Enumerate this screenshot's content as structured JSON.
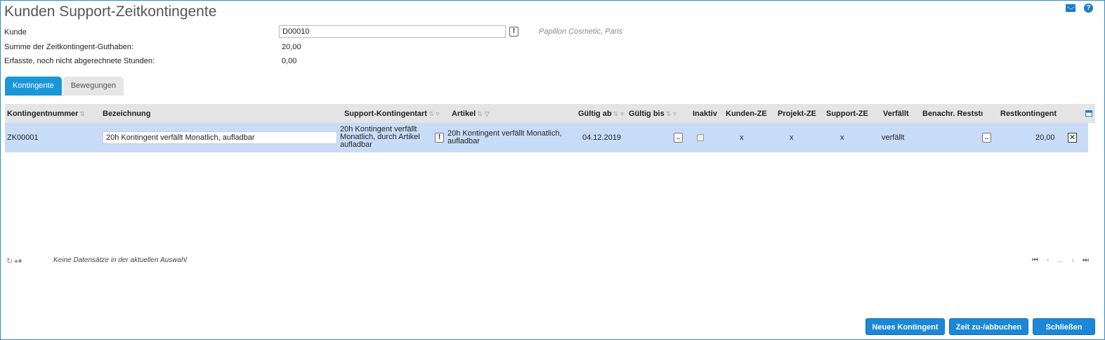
{
  "header": {
    "title": "Kunden Support-Zeitkontingente"
  },
  "icons": {
    "mail": "mail-icon",
    "help": "help-icon"
  },
  "form": {
    "kunde_label": "Kunde",
    "kunde_value": "D00010",
    "kunde_name": "Papillon Cosmetic, Paris",
    "summe_label": "Summe der Zeitkontingent-Guthaben:",
    "summe_value": "20,00",
    "erfasste_label": "Erfasste, noch nicht abgerechnete Stunden:",
    "erfasste_value": "0,00"
  },
  "tabs": [
    {
      "label": "Kontingente",
      "active": true
    },
    {
      "label": "Bewegungen",
      "active": false
    }
  ],
  "table": {
    "columns": {
      "kontingentnummer": "Kontingentnummer",
      "bezeichnung": "Bezeichnung",
      "support_kontingentart": "Support-Kontingentart",
      "artikel": "Artikel",
      "gueltig_ab": "Gültig ab",
      "gueltig_bis": "Gültig bis",
      "inaktiv": "Inaktiv",
      "kunden_ze": "Kunden-ZE",
      "projekt_ze": "Projekt-ZE",
      "support_ze": "Support-ZE",
      "verfaellt": "Verfällt",
      "benachr_reststd": "Benachr. Reststı",
      "restkontingent": "Restkontingent"
    },
    "rows": [
      {
        "kontingentnummer": "ZK00001",
        "bezeichnung": "20h Kontingent verfällt Monatlich, aufladbar",
        "support_kontingentart": "20h Kontingent verfällt Monatlich, durch Artikel aufladbar",
        "artikel": "20h Kontingent verfällt Monatlich, aufladbar",
        "gueltig_ab": "04.12.2019",
        "gueltig_bis_btn": "..",
        "inaktiv": false,
        "kunden_ze": "x",
        "projekt_ze": "x",
        "support_ze": "x",
        "verfaellt": "verfällt",
        "benachr_btn": "..",
        "restkontingent": "20,00",
        "delete_label": "✕"
      }
    ]
  },
  "footer": {
    "empty_message": "Keine Datensätze in der aktuellen Auswahl",
    "pager": {
      "first": "⏮",
      "prev": "‹",
      "ellipsis": "...",
      "next": "›",
      "last": "⏭"
    }
  },
  "buttons": {
    "new": "Neues Kontingent",
    "book": "Zeit zu-/abbuchen",
    "close": "Schließen"
  },
  "colors": {
    "accent": "#1b87d6",
    "selected_row": "#c9dcf7",
    "header_bg": "#e4e4e4"
  }
}
